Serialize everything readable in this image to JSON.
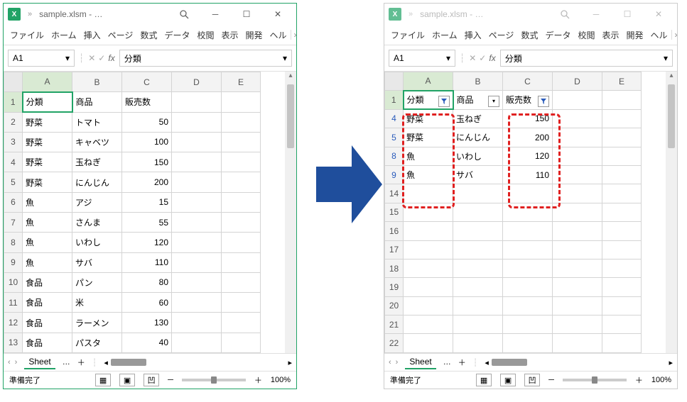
{
  "left": {
    "title": "sample.xlsm - …",
    "name_box": "A1",
    "formula": "分類",
    "menus": [
      "ファイル",
      "ホーム",
      "挿入",
      "ページ",
      "数式",
      "データ",
      "校閲",
      "表示",
      "開発",
      "ヘル"
    ],
    "columns": [
      "A",
      "B",
      "C",
      "D",
      "E"
    ],
    "rows": [
      "1",
      "2",
      "3",
      "4",
      "5",
      "6",
      "7",
      "8",
      "9",
      "10",
      "11",
      "12",
      "13"
    ],
    "cells": [
      {
        "r": "1",
        "A": "分類",
        "B": "商品",
        "C": "販売数"
      },
      {
        "r": "2",
        "A": "野菜",
        "B": "トマト",
        "C": "50"
      },
      {
        "r": "3",
        "A": "野菜",
        "B": "キャベツ",
        "C": "100"
      },
      {
        "r": "4",
        "A": "野菜",
        "B": "玉ねぎ",
        "C": "150"
      },
      {
        "r": "5",
        "A": "野菜",
        "B": "にんじん",
        "C": "200"
      },
      {
        "r": "6",
        "A": "魚",
        "B": "アジ",
        "C": "15"
      },
      {
        "r": "7",
        "A": "魚",
        "B": "さんま",
        "C": "55"
      },
      {
        "r": "8",
        "A": "魚",
        "B": "いわし",
        "C": "120"
      },
      {
        "r": "9",
        "A": "魚",
        "B": "サバ",
        "C": "110"
      },
      {
        "r": "10",
        "A": "食品",
        "B": "パン",
        "C": "80"
      },
      {
        "r": "11",
        "A": "食品",
        "B": "米",
        "C": "60"
      },
      {
        "r": "12",
        "A": "食品",
        "B": "ラーメン",
        "C": "130"
      },
      {
        "r": "13",
        "A": "食品",
        "B": "パスタ",
        "C": "40"
      }
    ],
    "sheet_name": "Sheet",
    "status": "準備完了",
    "zoom": "100%"
  },
  "right": {
    "title": "sample.xlsm - …",
    "name_box": "A1",
    "formula": "分類",
    "menus": [
      "ファイル",
      "ホーム",
      "挿入",
      "ページ",
      "数式",
      "データ",
      "校閲",
      "表示",
      "開発",
      "ヘル"
    ],
    "columns": [
      "A",
      "B",
      "C",
      "D",
      "E"
    ],
    "headers": {
      "A": "分類",
      "B": "商品",
      "C": "販売数"
    },
    "visible_rows": [
      "4",
      "5",
      "8",
      "9",
      "14",
      "15",
      "16",
      "17",
      "18",
      "19",
      "20",
      "21",
      "22"
    ],
    "cells": [
      {
        "r": "4",
        "A": "野菜",
        "B": "玉ねぎ",
        "C": "150"
      },
      {
        "r": "5",
        "A": "野菜",
        "B": "にんじん",
        "C": "200"
      },
      {
        "r": "8",
        "A": "魚",
        "B": "いわし",
        "C": "120"
      },
      {
        "r": "9",
        "A": "魚",
        "B": "サバ",
        "C": "110"
      }
    ],
    "filter_active": {
      "A": true,
      "B": false,
      "C": true
    },
    "sheet_name": "Sheet",
    "status": "準備完了",
    "zoom": "100%"
  }
}
